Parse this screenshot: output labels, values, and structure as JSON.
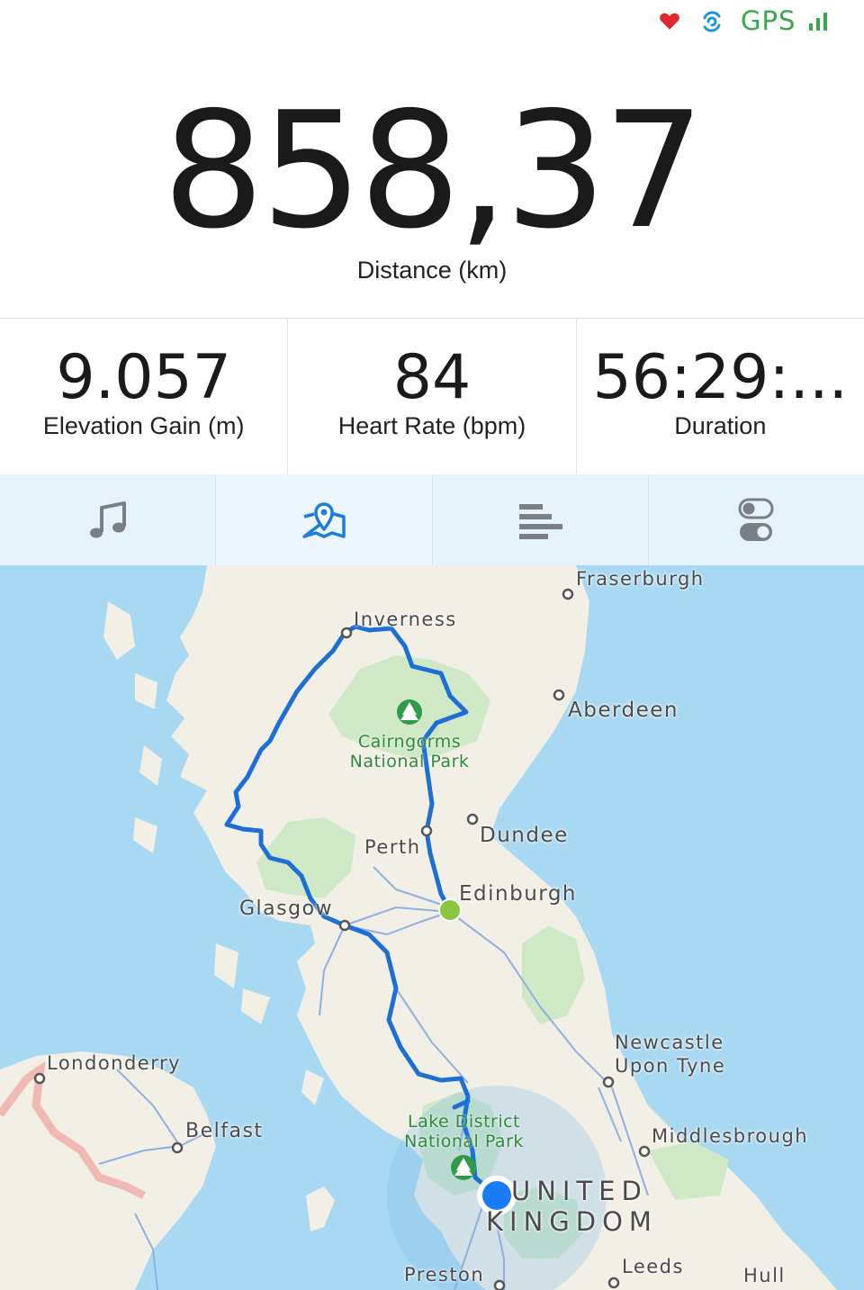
{
  "status": {
    "gps_label": "GPS"
  },
  "hero": {
    "distance": "858,37",
    "distance_label": "Distance (km)"
  },
  "stats": [
    {
      "value": "9.057",
      "label": "Elevation Gain (m)"
    },
    {
      "value": "84",
      "label": "Heart Rate (bpm)"
    },
    {
      "value": "56:29:...",
      "label": "Duration"
    }
  ],
  "tabs": [
    {
      "icon": "music-note-icon",
      "active": false
    },
    {
      "icon": "map-pin-icon",
      "active": true
    },
    {
      "icon": "bar-stats-icon",
      "active": false
    },
    {
      "icon": "toggle-settings-icon",
      "active": false
    }
  ],
  "colors": {
    "accent": "#1a7fd9",
    "gps": "#36a94b",
    "heart": "#e0262f",
    "route": "#1d6fd6",
    "start_dot": "#8cc63f",
    "current_dot": "#1a7cf5"
  },
  "map": {
    "places": {
      "fraserburgh": "Fraserburgh",
      "inverness": "Inverness",
      "aberdeen": "Aberdeen",
      "dundee": "Dundee",
      "perth": "Perth",
      "edinburgh": "Edinburgh",
      "glasgow": "Glasgow",
      "londonderry": "Londonderry",
      "belfast": "Belfast",
      "newcastle_1": "Newcastle",
      "newcastle_2": "Upon Tyne",
      "middlesbrough": "Middlesbrough",
      "preston": "Preston",
      "leeds": "Leeds",
      "hull": "Hull"
    },
    "parks": {
      "cairngorms_1": "Cairngorms",
      "cairngorms_2": "National Park",
      "lake_1": "Lake District",
      "lake_2": "National Park"
    },
    "country_1": "UNITED",
    "country_2": "KINGDOM"
  }
}
